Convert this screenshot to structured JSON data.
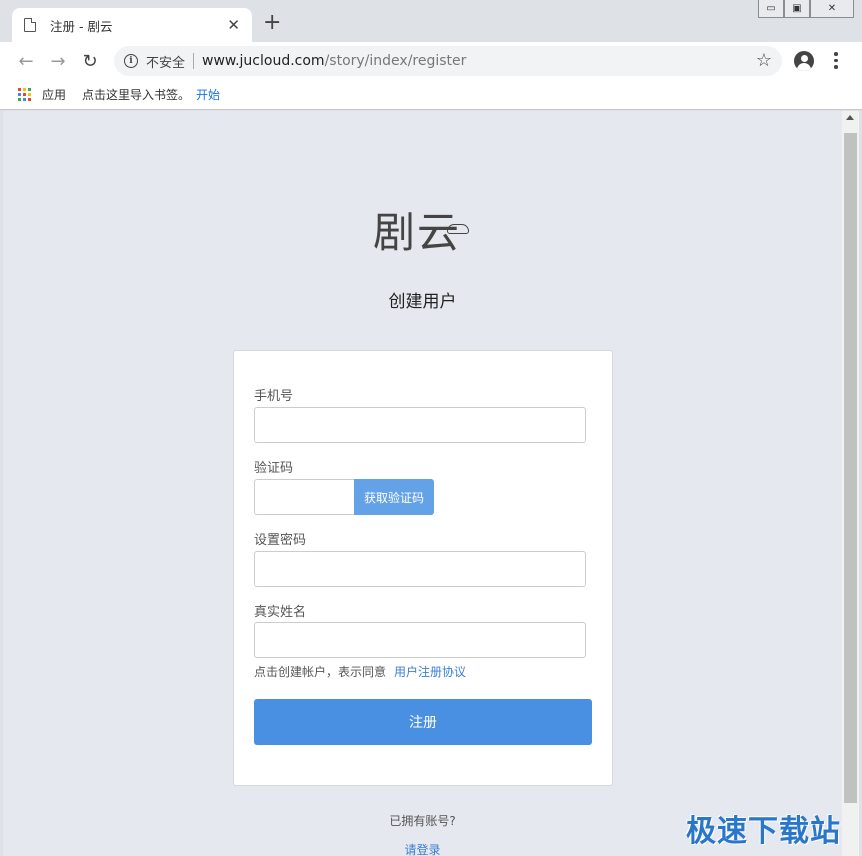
{
  "browser": {
    "tab_title": "注册 - 剧云",
    "tab_close": "✕",
    "new_tab": "+",
    "insecure_label": "不安全",
    "url_host": "www.jucloud.com",
    "url_path": "/story/index/register",
    "bookmarks": {
      "apps_label": "应用",
      "hint": "点击这里导入书签。",
      "start_label": "开始"
    }
  },
  "page": {
    "logo_text": "剧云",
    "heading": "创建用户",
    "form": {
      "phone_label": "手机号",
      "phone_value": "",
      "code_label": "验证码",
      "code_value": "",
      "get_code_button": "获取验证码",
      "password_label": "设置密码",
      "password_value": "",
      "realname_label": "真实姓名",
      "realname_value": "",
      "agree_text": "点击创建帐户，表示同意",
      "agreement_link": "用户注册协议",
      "submit_label": "注册"
    },
    "have_account": "已拥有账号?",
    "login_link": "请登录"
  },
  "watermark": "极速下载站",
  "colors": {
    "accent": "#4a90e2",
    "link": "#3a7fd4",
    "page_bg": "#e5e8ee"
  }
}
